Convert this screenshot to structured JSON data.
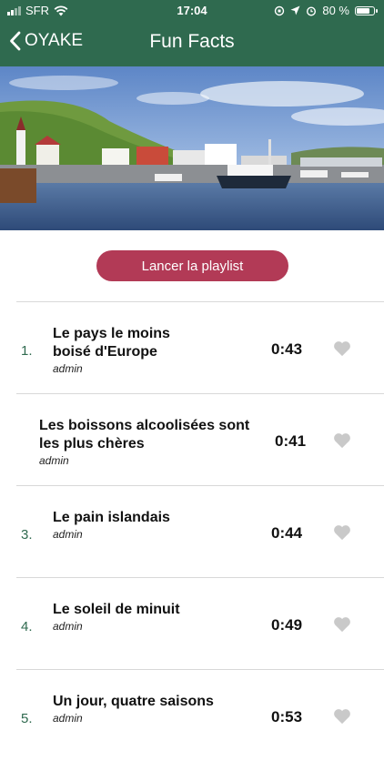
{
  "status": {
    "carrier": "SFR",
    "time": "17:04",
    "battery": "80 %",
    "battery_level": 0.8
  },
  "nav": {
    "back_label": "OYAKE",
    "title": "Fun Facts"
  },
  "colors": {
    "header": "#2f6a4f",
    "accent": "#b23a56"
  },
  "play_button": "Lancer la playlist",
  "tracks": [
    {
      "num": "1.",
      "title_lines": [
        "Le pays le moins",
        "boisé d'Europe"
      ],
      "author": "admin",
      "duration": "0:43"
    },
    {
      "num": "",
      "title_lines": [
        "Les boissons alcoolisées sont",
        "les plus chères"
      ],
      "author": "admin",
      "duration": "0:41"
    },
    {
      "num": "3.",
      "title_lines": [
        "Le pain islandais"
      ],
      "author": "admin",
      "duration": "0:44"
    },
    {
      "num": "4.",
      "title_lines": [
        "Le soleil de minuit"
      ],
      "author": "admin",
      "duration": "0:49"
    },
    {
      "num": "5.",
      "title_lines": [
        "Un jour, quatre saisons"
      ],
      "author": "admin",
      "duration": "0:53"
    }
  ]
}
